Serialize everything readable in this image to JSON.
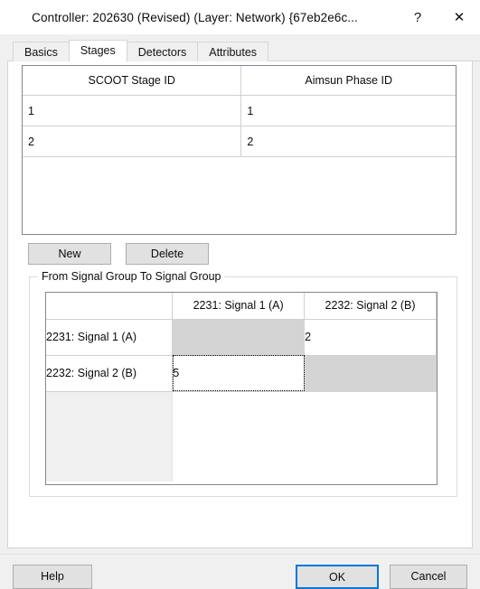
{
  "window": {
    "title": "Controller: 202630 (Revised) (Layer: Network) {67eb2e6c...",
    "help_glyph": "?",
    "close_glyph": "✕"
  },
  "tabs": [
    {
      "label": "Basics",
      "selected": false
    },
    {
      "label": "Stages",
      "selected": true
    },
    {
      "label": "Detectors",
      "selected": false
    },
    {
      "label": "Attributes",
      "selected": false
    }
  ],
  "stage_table": {
    "columns": [
      "SCOOT Stage ID",
      "Aimsun Phase ID"
    ],
    "rows": [
      [
        "1",
        "1"
      ],
      [
        "2",
        "2"
      ]
    ]
  },
  "row_buttons": {
    "new_label": "New",
    "delete_label": "Delete"
  },
  "group": {
    "title": "From Signal Group To Signal Group",
    "corner_label": "",
    "column_headers": [
      "2231: Signal 1 (A)",
      "2232: Signal 2 (B)"
    ],
    "row_headers": [
      "2231: Signal 1 (A)",
      "2232: Signal 2 (B)"
    ],
    "cells": [
      [
        "",
        "2"
      ],
      [
        "5",
        ""
      ]
    ]
  },
  "footer": {
    "help_label": "Help",
    "ok_label": "OK",
    "cancel_label": "Cancel"
  },
  "colors": {
    "accent": "#0078d7",
    "dialog_bg": "#f0f0f0",
    "panel_bg": "#ffffff",
    "disabled_cell": "#d4d4d4",
    "button_face": "#e1e1e1"
  }
}
